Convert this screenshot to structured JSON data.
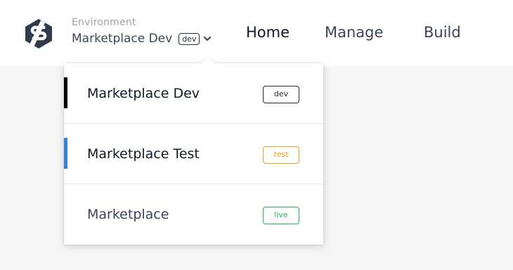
{
  "header": {
    "environment_label": "Environment",
    "current_environment": "Marketplace Dev",
    "current_badge": "dev",
    "nav": [
      "Home",
      "Manage",
      "Build"
    ]
  },
  "dropdown": {
    "options": [
      {
        "name": "Marketplace Dev",
        "badge": "dev",
        "badge_color": "#1f2937",
        "indicator_color": "#000000"
      },
      {
        "name": "Marketplace Test",
        "badge": "test",
        "badge_color": "#e8a317",
        "indicator_color": "#3b82d6"
      },
      {
        "name": "Marketplace",
        "badge": "live",
        "badge_color": "#22b25a",
        "indicator_color": ""
      }
    ]
  },
  "colors": {
    "logo": "#2f3b4c",
    "accent_blue": "#3b82d6"
  },
  "icons": [
    "logo-icon",
    "chevron-down-icon"
  ]
}
